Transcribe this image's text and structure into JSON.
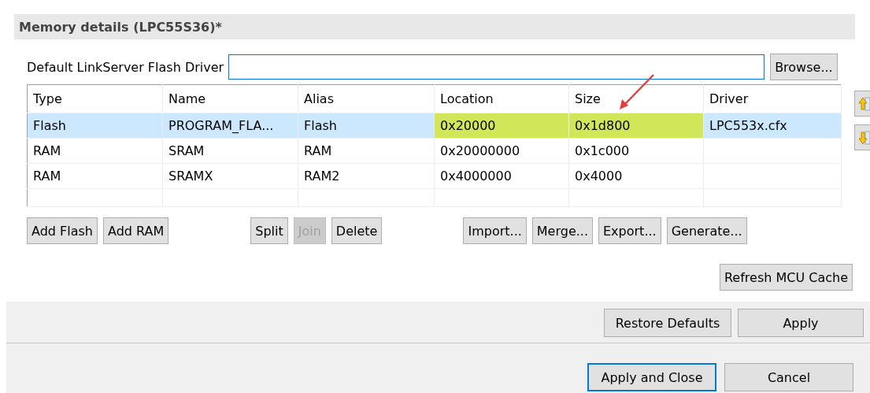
{
  "section": {
    "title": "Memory details (LPC55S36)*"
  },
  "driver": {
    "label": "Default LinkServer Flash Driver",
    "browse": "Browse..."
  },
  "table": {
    "columns": [
      "Type",
      "Name",
      "Alias",
      "Location",
      "Size",
      "Driver"
    ],
    "rows": [
      {
        "selected": true,
        "cells": [
          "Flash",
          "PROGRAM_FLA...",
          "Flash",
          "0x20000",
          "0x1d800",
          "LPC553x.cfx"
        ],
        "highlighted": [
          false,
          false,
          false,
          true,
          true,
          false
        ]
      },
      {
        "selected": false,
        "cells": [
          "RAM",
          "SRAM",
          "RAM",
          "0x20000000",
          "0x1c000",
          ""
        ],
        "highlighted": [
          false,
          false,
          false,
          false,
          false,
          false
        ]
      },
      {
        "selected": false,
        "cells": [
          "RAM",
          "SRAMX",
          "RAM2",
          "0x4000000",
          "0x4000",
          ""
        ],
        "highlighted": [
          false,
          false,
          false,
          false,
          false,
          false
        ]
      }
    ]
  },
  "actions": [
    {
      "label": "Add Flash",
      "disabled": false
    },
    {
      "label": "Add RAM",
      "disabled": false
    },
    {
      "label": "Split",
      "disabled": false
    },
    {
      "label": "Join",
      "disabled": true
    },
    {
      "label": "Delete",
      "disabled": false
    },
    {
      "label": "Import...",
      "disabled": false
    },
    {
      "label": "Merge...",
      "disabled": false
    },
    {
      "label": "Export...",
      "disabled": false
    },
    {
      "label": "Generate...",
      "disabled": false
    }
  ],
  "refresh": "Refresh MCU Cache",
  "page_buttons": [
    {
      "label": "Restore Defaults"
    },
    {
      "label": "Apply"
    }
  ],
  "dialog_buttons": [
    {
      "label": "Apply and Close",
      "default": true
    },
    {
      "label": "Cancel",
      "default": false
    }
  ]
}
